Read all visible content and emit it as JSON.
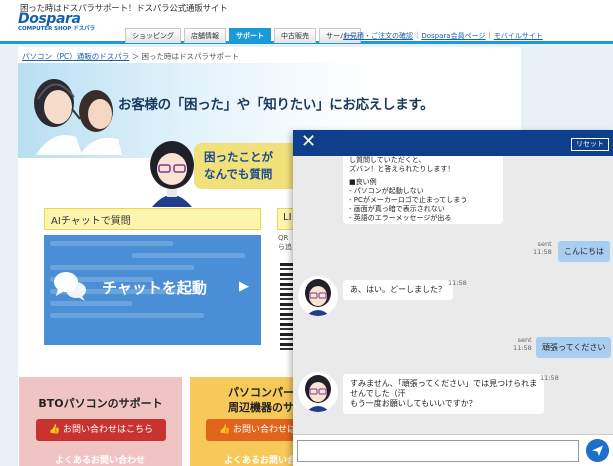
{
  "header": {
    "tagline": "困った時はドスパラサポート！ドスパラ公式通販サイト",
    "logo_main": "Dospara",
    "logo_sub": "COMPUTER SHOP ドスパラ",
    "tabs": [
      {
        "label": "ショッピング"
      },
      {
        "label": "店舗情報"
      },
      {
        "label": "サポート"
      },
      {
        "label": "中古販売"
      },
      {
        "label": "サーバー"
      }
    ],
    "links": [
      {
        "label": "お見積・ご注文の確認"
      },
      {
        "label": "Dospara会員ページ"
      },
      {
        "label": "モバイルサイト"
      }
    ]
  },
  "breadcrumb": {
    "link": "パソコン（PC）通販のドスパラ",
    "sep": "＞",
    "current": "困った時はドスパラサポート"
  },
  "hero": {
    "title": "お客様の「困った」や「知りたい」にお応えします。"
  },
  "question_bubble": {
    "line1": "困ったことが",
    "line2": "なんでも質問"
  },
  "ai_chat": {
    "label": "AIチャットで質問",
    "button_label": "チャットを起動",
    "arrow": "▶"
  },
  "line_section": {
    "label": "LI",
    "qr_text_1": "QR",
    "qr_text_2": "ら追"
  },
  "cards": {
    "bto": {
      "title": "BTOパソコンのサポート",
      "button": "お問い合わせはこちら",
      "faq": "よくあるお問い合わせ"
    },
    "peripheral": {
      "title_line1": "パソコンパー",
      "title_line2": "周辺機器のサポ",
      "button": "お問い合わせはこちら",
      "faq": "よくあるお問い合わせ"
    }
  },
  "chat": {
    "reset_label": "リセット",
    "close_symbol": "✕",
    "intro_lines": [
      "し質問していただくと、",
      "ズバン！と答えられたりします！",
      "",
      "■良い例",
      "- パソコンが起動しない",
      "- PCがメーカーロゴで止まってしまう",
      "- 画面が真っ暗で表示されない",
      "- 英語のエラーメッセージが出る"
    ],
    "messages": [
      {
        "sender": "user",
        "status": "sent",
        "time": "11:58",
        "text": "こんにちは"
      },
      {
        "sender": "bot",
        "time": "11:58",
        "lines": [
          "あ、はい。どーしました？"
        ]
      },
      {
        "sender": "user",
        "status": "sent",
        "time": "11:58",
        "text": "頑張ってください"
      },
      {
        "sender": "bot",
        "time": "11:58",
        "lines": [
          "すみません、「頑張ってください」では見つけられま",
          "せんでした（汗",
          "もう一度お願いしてもいいですか？"
        ]
      }
    ],
    "input_value": "",
    "input_placeholder": ""
  }
}
